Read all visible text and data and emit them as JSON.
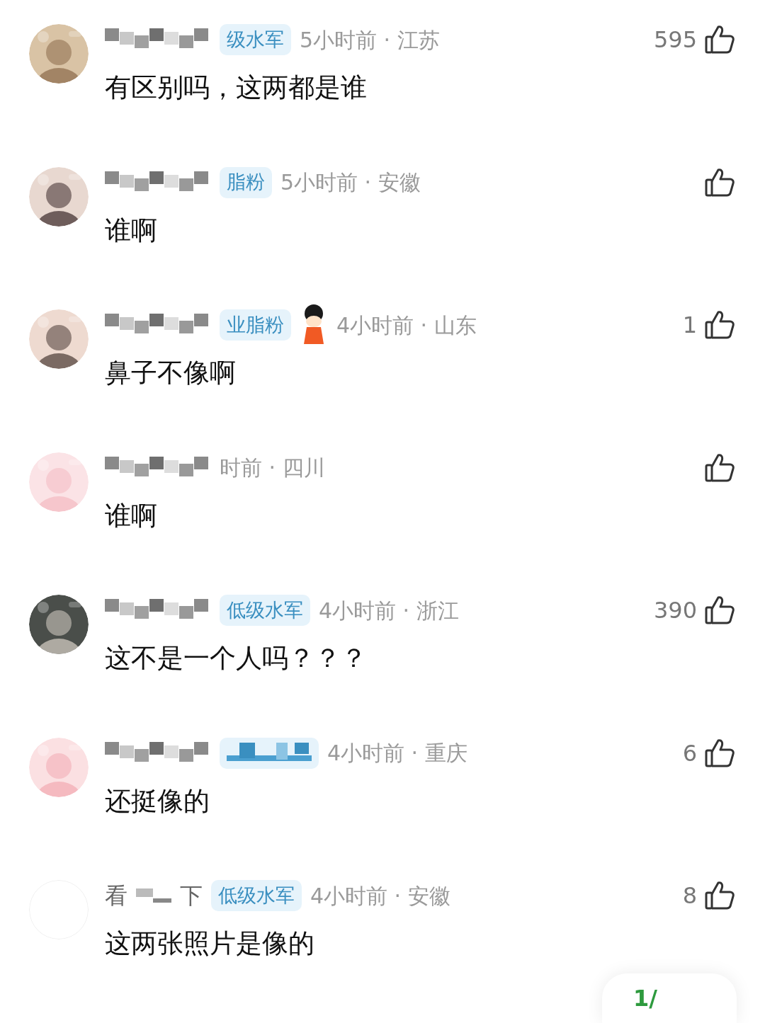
{
  "comments": [
    {
      "badge": "级水军",
      "has_icon": false,
      "meta": "5小时前 · 江苏",
      "likes": "595",
      "text": "有区别吗，这两都是谁"
    },
    {
      "badge": "脂粉",
      "has_icon": false,
      "meta": "5小时前 · 安徽",
      "text": "谁啊"
    },
    {
      "badge": "业脂粉",
      "has_icon": true,
      "meta": "4小时前 · 山东",
      "likes": "1",
      "text": "鼻子不像啊"
    },
    {
      "meta": "时前 · 四川",
      "has_icon": false,
      "text": "谁啊"
    },
    {
      "badge": "低级水军",
      "has_icon": false,
      "meta": "4小时前 · 浙江",
      "likes": "390",
      "text": "这不是一个人吗？？？"
    },
    {
      "badge_obscured": true,
      "has_icon": false,
      "meta": "4小时前 · 重庆",
      "likes": "6",
      "text": "还挺像的"
    },
    {
      "name_parts": [
        "看",
        "下"
      ],
      "badge": "低级水军",
      "has_icon": false,
      "meta": "4小时前 · 安徽",
      "likes": "8",
      "text": "这两张照片是像的"
    }
  ],
  "pager": "1/"
}
